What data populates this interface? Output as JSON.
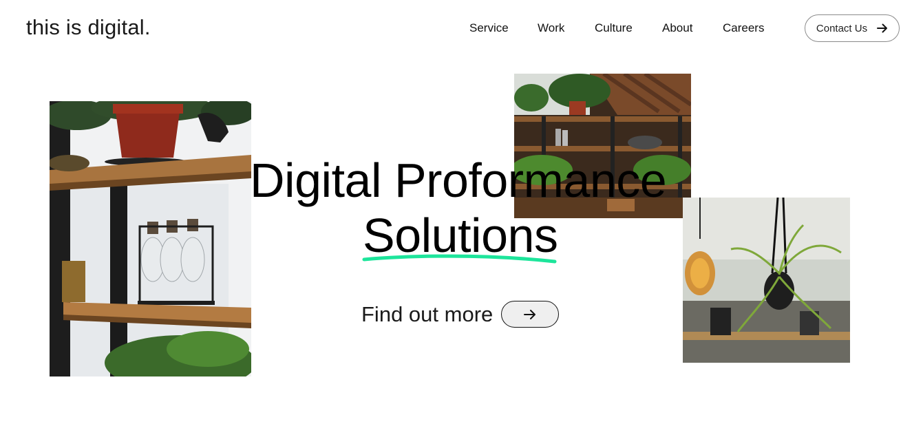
{
  "header": {
    "logo": "this is digital.",
    "nav": [
      {
        "label": "Service"
      },
      {
        "label": "Work"
      },
      {
        "label": "Culture"
      },
      {
        "label": "About"
      },
      {
        "label": "Careers"
      }
    ],
    "contact_label": "Contact Us",
    "contact_icon": "arrow-right-icon"
  },
  "hero": {
    "title_line1": "Digital Proformance",
    "title_line2": "Solutions",
    "underline_color": "#1de59b",
    "cta_label": "Find out more",
    "cta_icon": "arrow-right-icon"
  },
  "images": [
    {
      "name": "shelf-with-plants-and-bottles-photo"
    },
    {
      "name": "office-shelves-with-plants-photo"
    },
    {
      "name": "hanging-plant-and-bulb-photo"
    }
  ]
}
